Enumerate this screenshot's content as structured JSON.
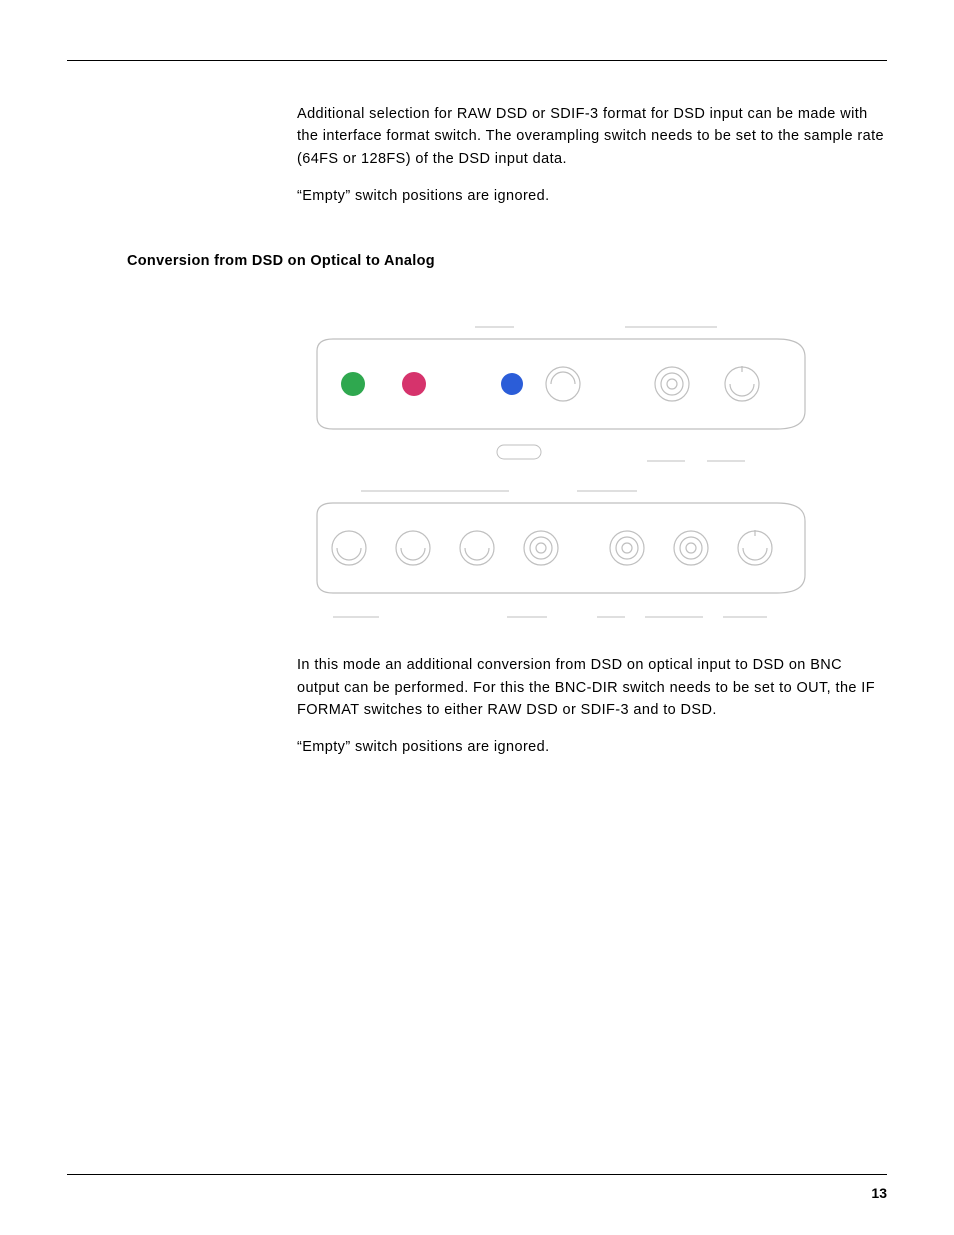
{
  "paragraphs": {
    "p1": "Additional selection for RAW DSD or SDIF-3 format for DSD input can be made with the interface format switch. The overampling switch needs to be set to the sample rate (64FS or 128FS) of the DSD input data.",
    "p2": "“Empty” switch positions are ignored.",
    "p3": "In this mode an additional conversion from DSD on optical input to DSD on BNC output can be performed. For this the BNC-DIR switch needs to be set to OUT, the IF FORMAT switches to either RAW DSD or SDIF-3 and to DSD.",
    "p4": "“Empty” switch positions are ignored."
  },
  "heading": "Conversion from DSD on Optical to Analog",
  "pageNumber": "13",
  "diagram": {
    "leds": {
      "green": "#2fa84f",
      "red": "#d6336c",
      "blue": "#2b5dd8"
    },
    "stroke": "#bfbfbf"
  }
}
